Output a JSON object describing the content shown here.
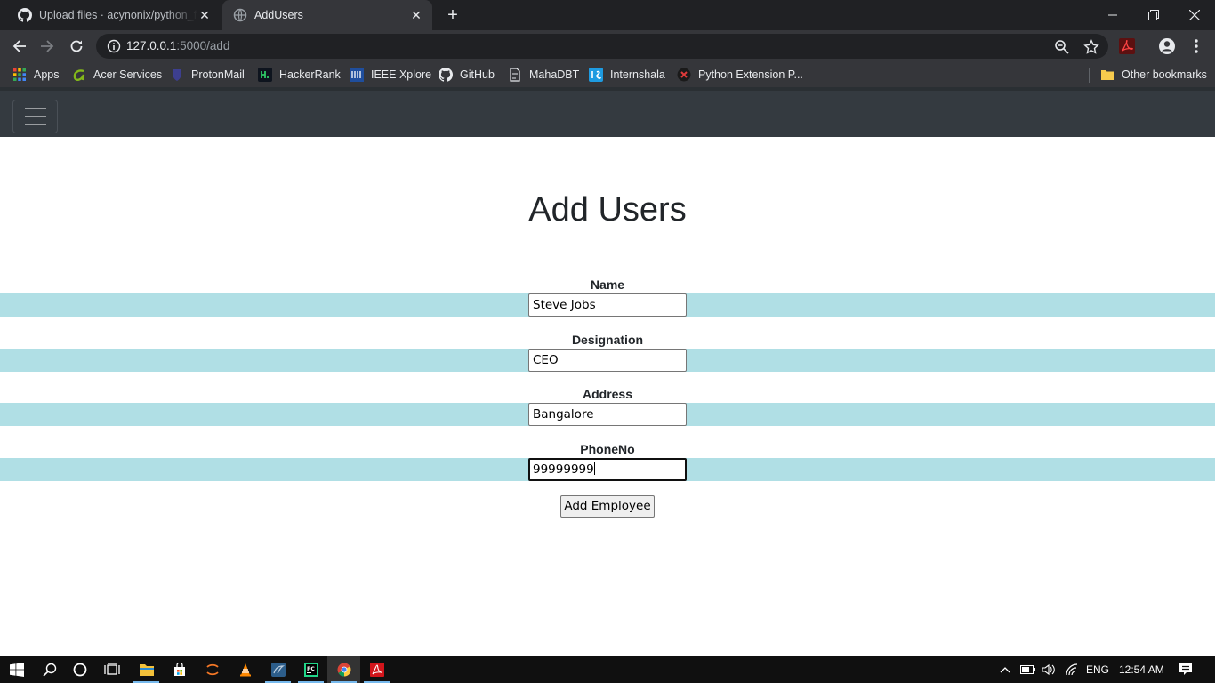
{
  "browser": {
    "tabs": [
      {
        "title": "Upload files · acynonix/python_fl",
        "active": false
      },
      {
        "title": "AddUsers",
        "active": true
      }
    ],
    "close_glyph": "✕",
    "new_tab_glyph": "+",
    "url_host": "127.0.0.1",
    "url_path": ":5000/add",
    "bookmarks": [
      {
        "label": "Apps",
        "icon": "apps-grid-icon"
      },
      {
        "label": "Acer Services",
        "icon": "acer-icon"
      },
      {
        "label": "ProtonMail",
        "icon": "protonmail-icon"
      },
      {
        "label": "HackerRank",
        "icon": "hackerrank-icon"
      },
      {
        "label": "IEEE Xplore",
        "icon": "ieee-icon"
      },
      {
        "label": "GitHub",
        "icon": "github-icon"
      },
      {
        "label": "MahaDBT",
        "icon": "document-icon"
      },
      {
        "label": "Internshala",
        "icon": "internshala-icon"
      },
      {
        "label": "Python Extension P...",
        "icon": "python-ext-icon"
      }
    ],
    "other_bookmarks": "Other bookmarks"
  },
  "page": {
    "title": "Add Users",
    "fields": [
      {
        "label": "Name",
        "value": "Steve Jobs"
      },
      {
        "label": "Designation",
        "value": "CEO"
      },
      {
        "label": "Address",
        "value": "Bangalore"
      },
      {
        "label": "PhoneNo",
        "value": "99999999"
      }
    ],
    "submit_label": "Add Employee",
    "band_color": "#b0dfe5",
    "navbar_color": "#343a40"
  },
  "taskbar": {
    "language": "ENG",
    "time": "12:54 AM"
  }
}
